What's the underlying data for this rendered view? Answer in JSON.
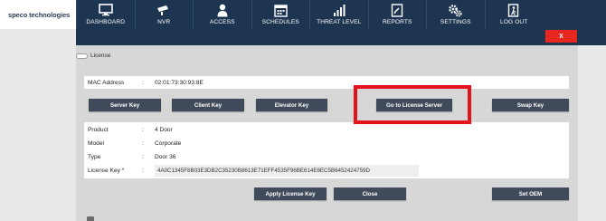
{
  "app": {
    "logo": "speco technologies"
  },
  "nav": {
    "items": [
      {
        "label": "DASHBOARD",
        "icon": "monitor-icon"
      },
      {
        "label": "NVR",
        "icon": "camera-icon"
      },
      {
        "label": "ACCESS",
        "icon": "person-icon"
      },
      {
        "label": "SCHEDULES",
        "icon": "calendar-icon"
      },
      {
        "label": "THREAT LEVEL",
        "icon": "signal-bars-icon"
      },
      {
        "label": "REPORTS",
        "icon": "report-icon"
      },
      {
        "label": "SETTINGS",
        "icon": "gears-icon"
      },
      {
        "label": "LOG OUT",
        "icon": "exit-icon"
      }
    ]
  },
  "window": {
    "close_label": "X"
  },
  "license": {
    "section_title": "License",
    "mac_label": "MAC Address",
    "mac_value": "02:01:73:30:93:8E",
    "buttons": {
      "server_key": "Server Key",
      "client_key": "Client Key",
      "elevator_key": "Elevator Key",
      "go_to_server": "Go to License Server",
      "swap_key": "Swap Key"
    },
    "fields": [
      {
        "label": "Product",
        "value": "4 Door"
      },
      {
        "label": "Model",
        "value": "Corporate"
      },
      {
        "label": "Type",
        "value": "Door 36"
      }
    ],
    "license_key_label": "License Key *",
    "license_key_value": "4A0C1345F8B03E3DB2C35230B8613E71EFF4535F96BE614E6EC5B6452424759D",
    "actions": {
      "apply": "Apply License Key",
      "close": "Close",
      "set_oem": "Set OEM"
    },
    "separator": ":"
  },
  "colors": {
    "nav_bg": "#1e3552",
    "button_bg": "#3f4a5a",
    "close_bg": "#e6271f",
    "highlight": "#e3121b"
  }
}
